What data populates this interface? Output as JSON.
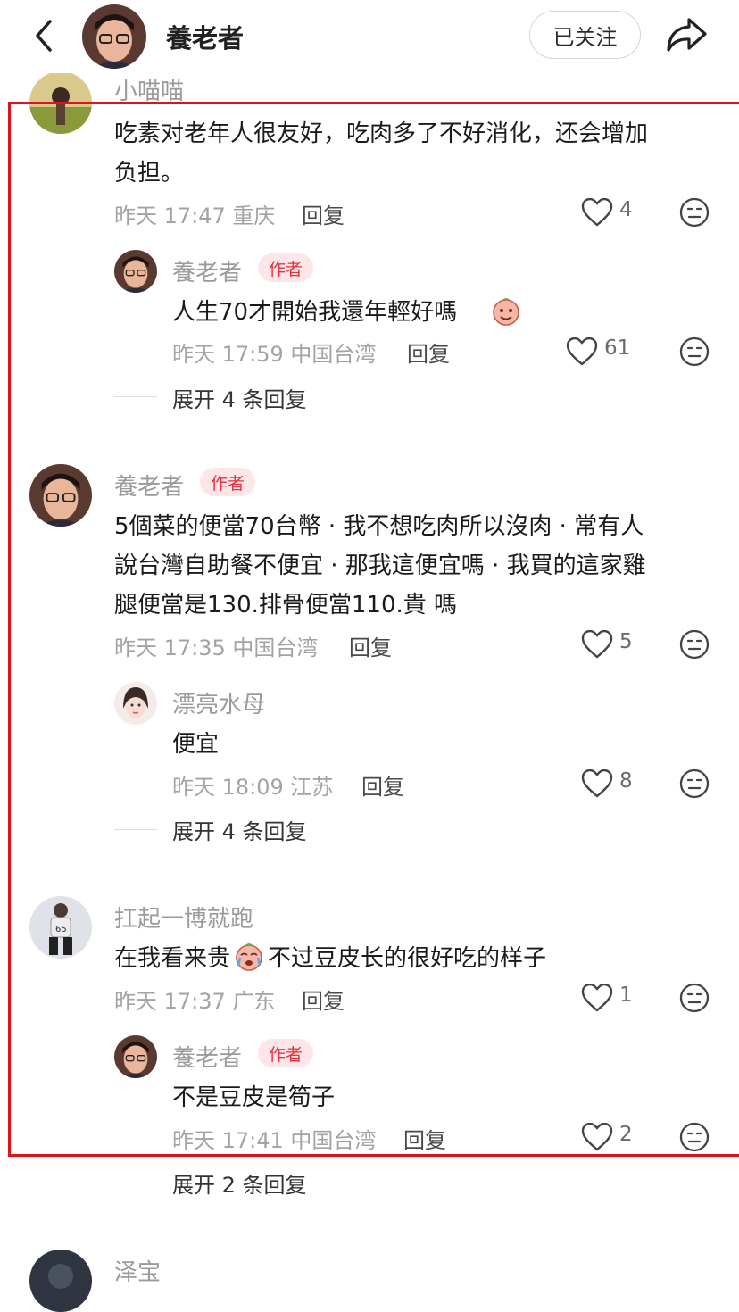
{
  "header": {
    "name": "養老者",
    "follow_label": "已关注"
  },
  "comments": [
    {
      "user": "小喵喵",
      "text": [
        "吃素对老年人很友好，吃肉多了不好消化，还会增加",
        "负担。"
      ],
      "meta": "昨天 17:47 重庆",
      "reply": "回复",
      "likes": "4"
    },
    {
      "user": "養老者",
      "tag": "作者",
      "text": [
        "人生70才開始我還年輕好嗎"
      ],
      "meta": "昨天 17:59 中国台湾",
      "reply": "回复",
      "likes": "61"
    },
    {
      "user": "養老者",
      "tag": "作者",
      "text": [
        "5個菜的便當70台幣 · 我不想吃肉所以沒肉 · 常有人",
        "說台灣自助餐不便宜 · 那我這便宜嗎 · 我買的這家雞",
        "腿便當是130.排骨便當110.貴 嗎"
      ],
      "meta": "昨天 17:35 中国台湾",
      "reply": "回复",
      "likes": "5"
    },
    {
      "user": "漂亮水母",
      "text": [
        "便宜"
      ],
      "meta": "昨天 18:09 江苏",
      "reply": "回复",
      "likes": "8"
    },
    {
      "user": "扛起一博就跑",
      "text_a": "在我看来贵",
      "text_b": "不过豆皮长的很好吃的样子",
      "meta": "昨天 17:37 广东",
      "reply": "回复",
      "likes": "1"
    },
    {
      "user": "養老者",
      "tag": "作者",
      "text": [
        "不是豆皮是筍子"
      ],
      "meta": "昨天 17:41 中国台湾",
      "reply": "回复",
      "likes": "2"
    },
    {
      "user": "泽宝"
    }
  ],
  "expand": [
    {
      "label": "展开 4 条回复"
    },
    {
      "label": "展开 4 条回复"
    },
    {
      "label": "展开 2 条回复"
    }
  ],
  "colors": {
    "author_tag": "#e8303f",
    "highlight_border": "#e0131c"
  },
  "icons": [
    "back-icon",
    "share-icon",
    "heart-icon",
    "dislike-face-icon",
    "emoji-icon"
  ]
}
